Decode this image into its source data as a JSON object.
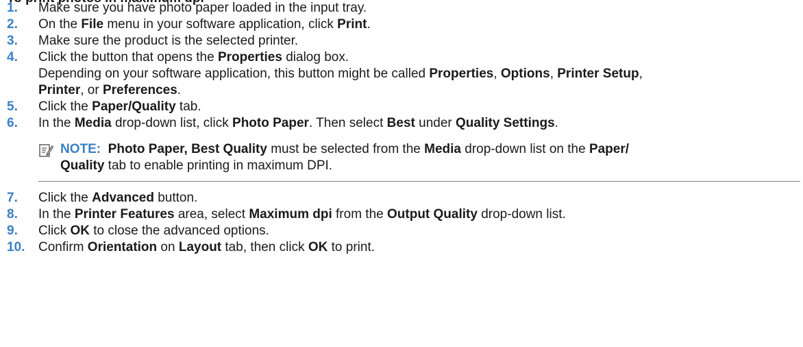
{
  "heading_clipped": "To print photos in maximum dpi",
  "steps": [
    {
      "num": "1.",
      "t1": "Make sure you have photo paper loaded in the input tray."
    },
    {
      "num": "2.",
      "t1": "On the ",
      "b1": "File",
      "t2": " menu in your software application, click ",
      "b2": "Print",
      "t3": "."
    },
    {
      "num": "3.",
      "t1": "Make sure the product is the selected printer."
    },
    {
      "num": "4.",
      "t1": "Click the button that opens the ",
      "b1": "Properties",
      "t2": " dialog box.",
      "para": {
        "t1": "Depending on your software application, this button might be called ",
        "b1": "Properties",
        "t2": ", ",
        "b2": "Options",
        "t3": ", ",
        "b3": "Printer Setup",
        "t4": ",",
        "b4": "Printer",
        "t5": ", or ",
        "b5": "Preferences",
        "t6": "."
      }
    },
    {
      "num": "5.",
      "t1": "Click the ",
      "b1": "Paper/Quality",
      "t2": " tab."
    },
    {
      "num": "6.",
      "t1": "In the ",
      "b1": "Media",
      "t2": " drop-down list, click ",
      "b2": "Photo Paper",
      "t3": ". Then select ",
      "b3": "Best",
      "t4": " under ",
      "b4": "Quality Settings",
      "t5": "."
    },
    {
      "num": "7.",
      "t1": "Click the ",
      "b1": "Advanced",
      "t2": " button."
    },
    {
      "num": "8.",
      "t1": "In the ",
      "b1": "Printer Features",
      "t2": " area, select ",
      "b2": "Maximum dpi",
      "t3": " from the ",
      "b3": "Output Quality",
      "t4": " drop-down list."
    },
    {
      "num": "9.",
      "t1": "Click ",
      "b1": "OK",
      "t2": " to close the advanced options."
    },
    {
      "num": "10.",
      "t1": "Confirm ",
      "b1": "Orientation",
      "t2": " on ",
      "b2": "Layout",
      "t3": " tab, then click ",
      "b3": "OK",
      "t4": " to print."
    }
  ],
  "note": {
    "icon": "note-pencil-icon",
    "label": "NOTE:",
    "b1": "Photo Paper, Best Quality",
    "t1": " must be selected from the ",
    "b2": "Media",
    "t2": " drop-down list on the ",
    "b3": "Paper/",
    "b4": "Quality",
    "t3": " tab to enable printing in maximum DPI."
  },
  "colors": {
    "accent": "#3b7fc4",
    "text": "#1a1a1a",
    "rule": "#7a7a7a"
  }
}
